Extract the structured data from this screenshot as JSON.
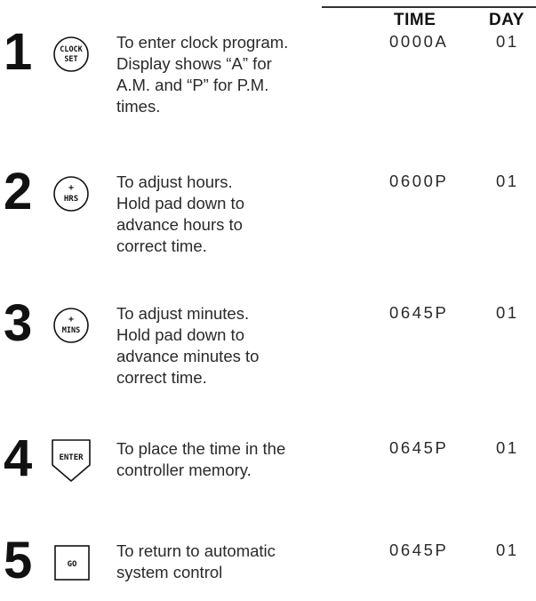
{
  "header": {
    "time_label": "TIME",
    "day_label": "DAY"
  },
  "steps": [
    {
      "number": "1",
      "icon": "clock-set-button-icon",
      "icon_text": [
        "CLOCK",
        "SET"
      ],
      "lines": [
        "To enter clock program.",
        "Display shows “A” for",
        "A.M. and “P” for P.M.",
        "times."
      ],
      "time": "0000A",
      "day": "01"
    },
    {
      "number": "2",
      "icon": "plus-hrs-button-icon",
      "icon_text": [
        "+",
        "HRS"
      ],
      "lines": [
        "To adjust hours.",
        "Hold pad down to",
        "advance hours to",
        "correct time."
      ],
      "time": "0600P",
      "day": "01"
    },
    {
      "number": "3",
      "icon": "plus-mins-button-icon",
      "icon_text": [
        "+",
        "MINS"
      ],
      "lines": [
        "To adjust minutes.",
        "Hold pad down to",
        "advance minutes to",
        "correct time."
      ],
      "time": "0645P",
      "day": "01"
    },
    {
      "number": "4",
      "icon": "enter-button-icon",
      "icon_text": [
        "ENTER"
      ],
      "lines": [
        "To place the time in the",
        "controller memory."
      ],
      "time": "0645P",
      "day": "01"
    },
    {
      "number": "5",
      "icon": "go-button-icon",
      "icon_text": [
        "GO"
      ],
      "lines": [
        "To return to automatic",
        "system control"
      ],
      "time": "0645P",
      "day": "01"
    }
  ]
}
